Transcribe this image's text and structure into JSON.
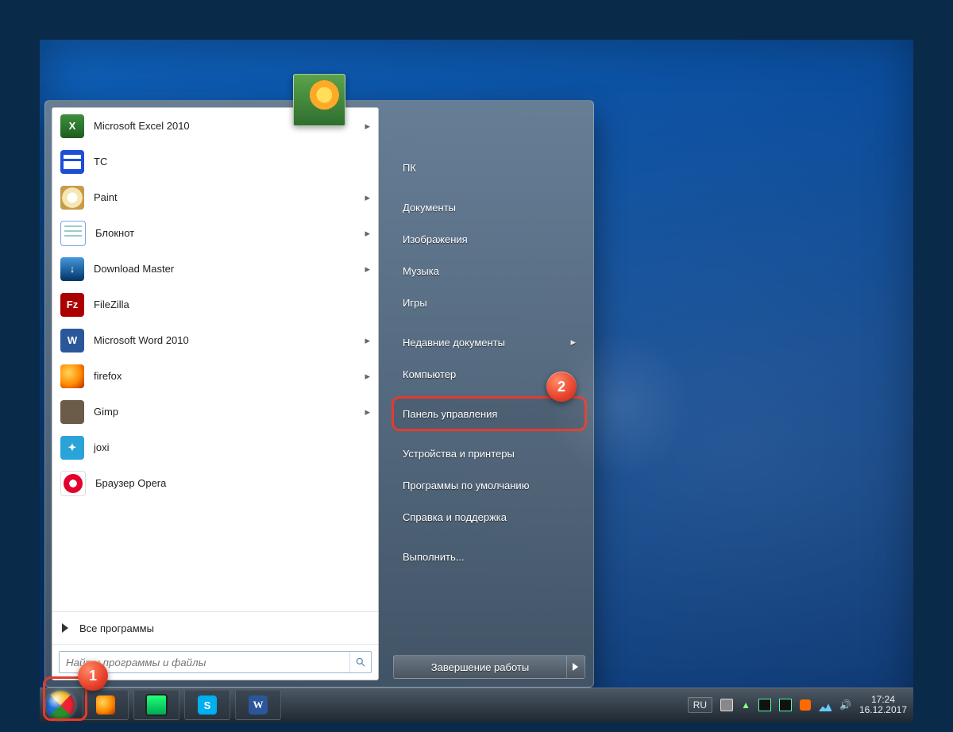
{
  "annotations": {
    "badge1": "1",
    "badge2": "2"
  },
  "start_menu": {
    "programs": [
      {
        "label": "Microsoft Excel 2010",
        "icon": "excel",
        "has_sub": true
      },
      {
        "label": "TC",
        "icon": "tc",
        "has_sub": false
      },
      {
        "label": "Paint",
        "icon": "paint",
        "has_sub": true
      },
      {
        "label": "Блокнот",
        "icon": "note",
        "has_sub": true
      },
      {
        "label": "Download Master",
        "icon": "dm",
        "has_sub": true
      },
      {
        "label": "FileZilla",
        "icon": "fz",
        "has_sub": false
      },
      {
        "label": "Microsoft Word 2010",
        "icon": "word",
        "has_sub": true
      },
      {
        "label": "firefox",
        "icon": "ff",
        "has_sub": true
      },
      {
        "label": "Gimp",
        "icon": "gimp",
        "has_sub": true
      },
      {
        "label": "joxi",
        "icon": "joxi",
        "has_sub": false
      },
      {
        "label": "Браузер Opera",
        "icon": "opera",
        "has_sub": false
      }
    ],
    "all_programs": "Все программы",
    "search_placeholder": "Найти программы и файлы",
    "right": [
      {
        "label": "ПК"
      },
      {
        "label": "Документы"
      },
      {
        "label": "Изображения"
      },
      {
        "label": "Музыка"
      },
      {
        "label": "Игры"
      },
      {
        "label": "Недавние документы",
        "has_sub": true
      },
      {
        "label": "Компьютер"
      },
      {
        "label": "Панель управления",
        "highlight": true
      },
      {
        "label": "Устройства и принтеры"
      },
      {
        "label": "Программы по умолчанию"
      },
      {
        "label": "Справка и поддержка"
      },
      {
        "label": "Выполнить..."
      }
    ],
    "shutdown_label": "Завершение работы"
  },
  "taskbar": {
    "lang": "RU",
    "time": "17:24",
    "date": "16.12.2017"
  }
}
